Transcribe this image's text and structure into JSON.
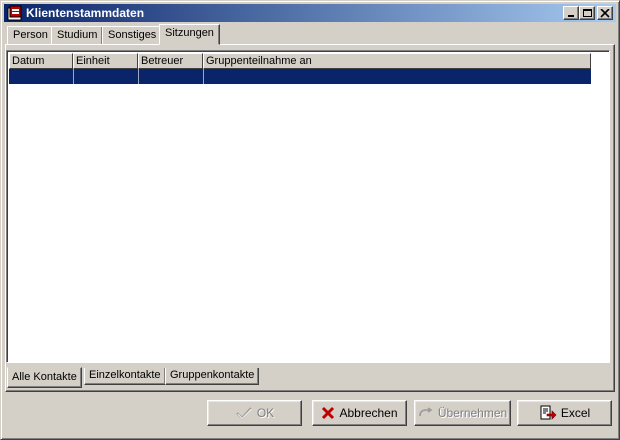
{
  "window": {
    "title": "Klientenstammdaten"
  },
  "title_buttons": [
    "minimize-icon",
    "maximize-icon",
    "close-icon"
  ],
  "tabs": [
    {
      "label": "Person",
      "active": false
    },
    {
      "label": "Studium",
      "active": false
    },
    {
      "label": "Sonstiges",
      "active": false
    },
    {
      "label": "Sitzungen",
      "active": true
    }
  ],
  "table": {
    "columns": [
      "Datum",
      "Einheit",
      "Betreuer",
      "Gruppenteilnahme an"
    ],
    "rows": [
      [
        "",
        "",
        "",
        ""
      ]
    ],
    "selected_row": 0
  },
  "subtabs": [
    {
      "label": "Alle Kontakte",
      "active": true
    },
    {
      "label": "Einzelkontakte",
      "active": false
    },
    {
      "label": "Gruppenkontakte",
      "active": false
    }
  ],
  "buttons": {
    "ok": {
      "label": "OK",
      "icon": "checkmark-icon",
      "enabled": false
    },
    "cancel": {
      "label": "Abbrechen",
      "icon": "red-x-icon",
      "enabled": true
    },
    "apply": {
      "label": "Übernehmen",
      "icon": "apply-arrow-icon",
      "enabled": false
    },
    "excel": {
      "label": "Excel",
      "icon": "export-icon",
      "enabled": true
    }
  },
  "colors": {
    "titlebar_start": "#0a246a",
    "titlebar_end": "#a6caf0",
    "selection": "#0a246a",
    "face": "#d4d0c8"
  }
}
